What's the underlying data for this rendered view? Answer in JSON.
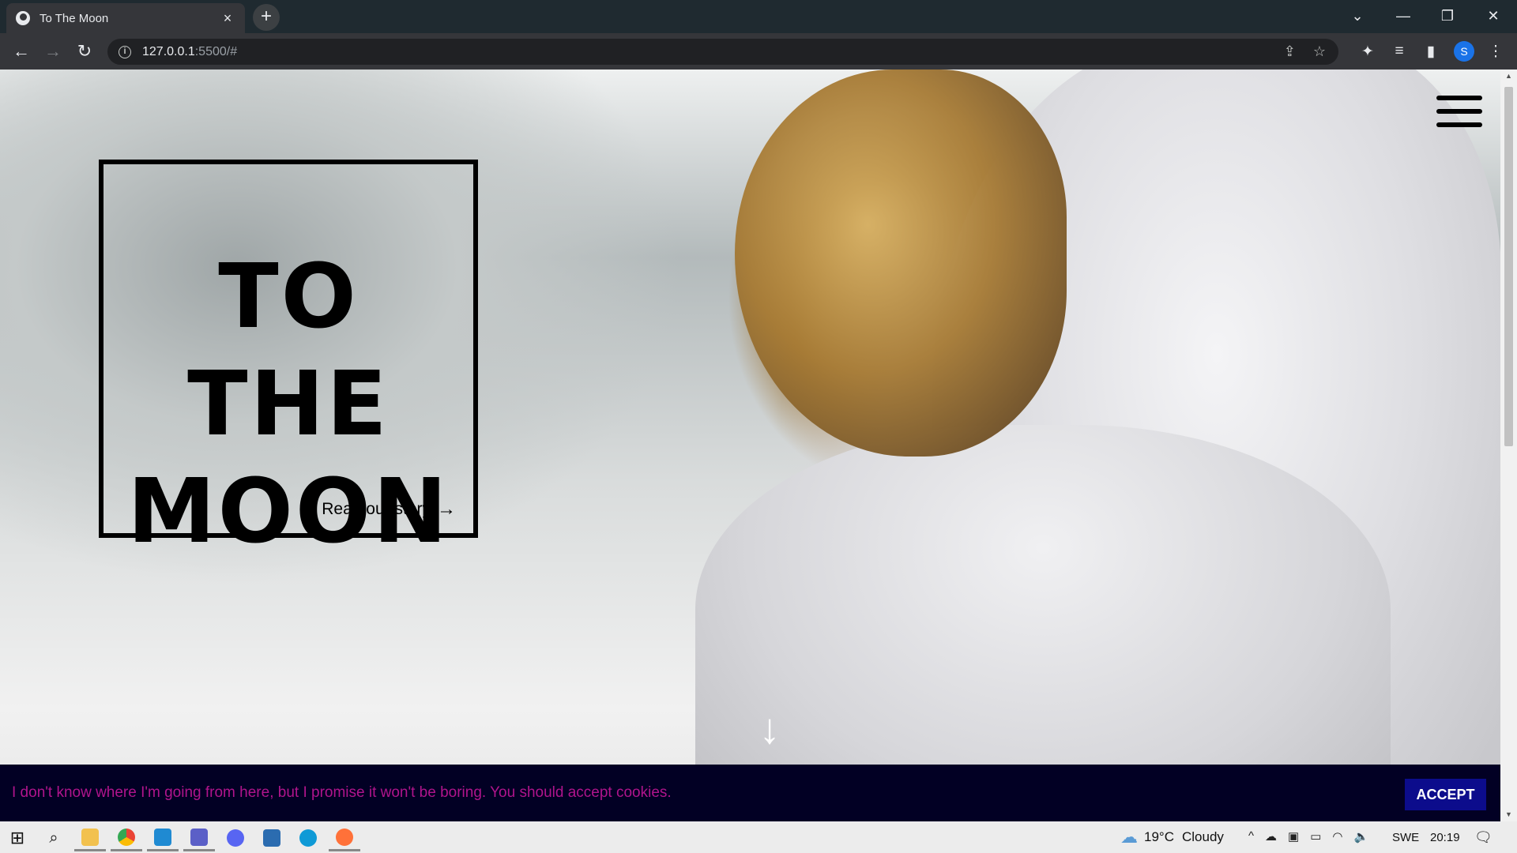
{
  "browser": {
    "tab_title": "To The Moon",
    "tab_close": "×",
    "new_tab": "+",
    "url_host": "127.0.0.1",
    "url_path": ":5500/#",
    "avatar_letter": "S"
  },
  "hero": {
    "title_line1": "TO THE",
    "title_line2": "MOON",
    "story_link": "Read our story",
    "story_arrow": "→",
    "scroll_arrow": "↓"
  },
  "cookie_banner": {
    "message": "I don't know where I'm going from here, but I promise it won't be boring. You should accept cookies.",
    "accept_label": "ACCEPT"
  },
  "taskbar": {
    "weather_temp": "19°C",
    "weather_text": "Cloudy",
    "language": "SWE",
    "clock": "20:19"
  },
  "colors": {
    "cookie_bg": "#020024",
    "cookie_text": "#b0148c",
    "accept_bg": "#0c0c8c"
  }
}
